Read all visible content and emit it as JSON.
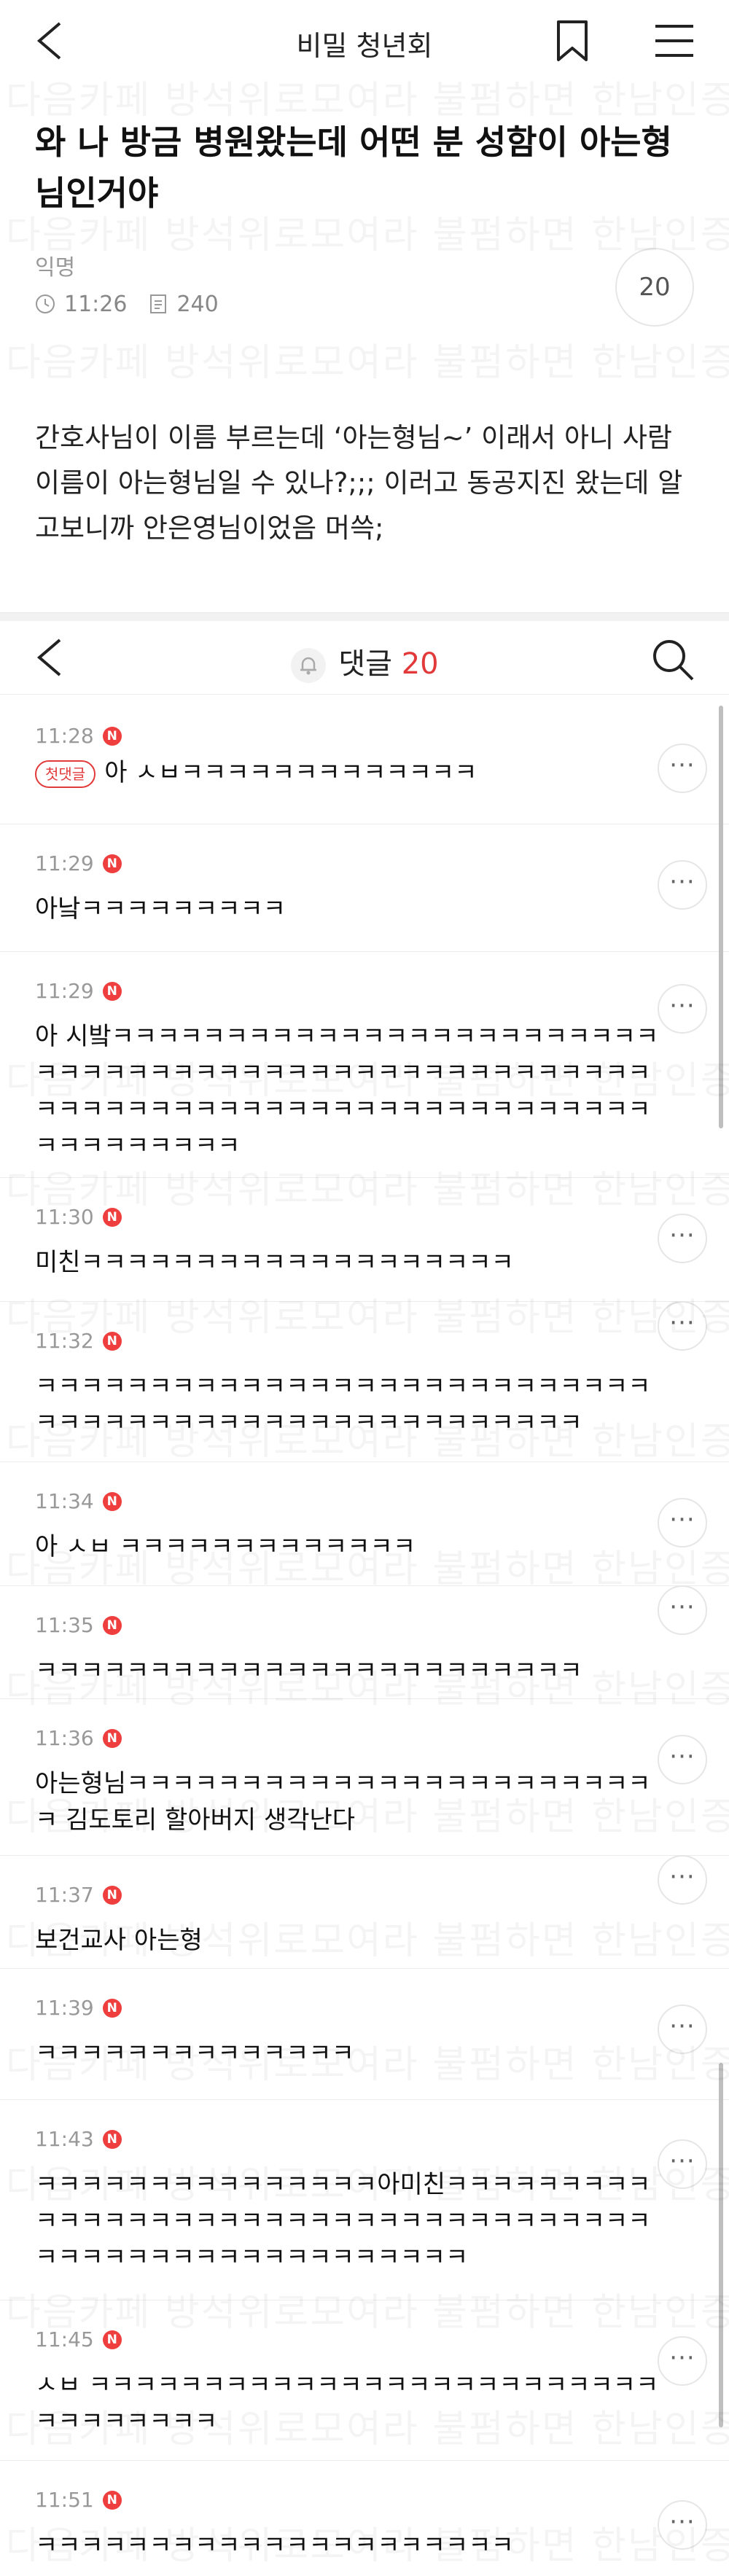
{
  "header": {
    "title": "비밀 청년회"
  },
  "post": {
    "title": "와 나 방금 병원왔는데 어떤 분 성함이 아는형님인거야",
    "author": "익명",
    "time": "11:26",
    "views": "240",
    "comment_count": "20",
    "body": "간호사님이 이름 부르는데 ‘아는형님~’ 이래서 아니 사람 이름이 아는형님일 수 있나?;;; 이러고 동공지진 왔는데 알고보니까 안은영님이었음 머쓱;"
  },
  "comments_header": {
    "label": "댓글",
    "count": "20"
  },
  "badge_letter": "N",
  "first_comment_badge": "첫댓글",
  "more_glyph": "···",
  "watermark": "다음카페 방석위로모여라 불펌하면 한남인증",
  "comments": [
    {
      "time": "11:28",
      "text": "아 ㅅㅂㅋㅋㅋㅋㅋㅋㅋㅋㅋㅋㅋㅋㅋ"
    },
    {
      "time": "11:29",
      "text": "아낰ㅋㅋㅋㅋㅋㅋㅋㅋㅋ"
    },
    {
      "time": "11:29",
      "text": "아 시밬ㅋㅋㅋㅋㅋㅋㅋㅋㅋㅋㅋㅋㅋㅋㅋㅋㅋㅋㅋㅋㅋㅋㅋㅋㅋㅋㅋㅋㅋㅋㅋㅋㅋㅋㅋㅋㅋㅋㅋㅋㅋㅋㅋㅋㅋㅋㅋㅋㅋㅋㅋㅋㅋㅋㅋㅋㅋㅋㅋㅋㅋㅋㅋㅋㅋㅋㅋㅋㅋㅋㅋㅋㅋㅋㅋㅋㅋㅋㅋㅋㅋㅋㅋㅋㅋㅋㅋ"
    },
    {
      "time": "11:30",
      "text": "미친ㅋㅋㅋㅋㅋㅋㅋㅋㅋㅋㅋㅋㅋㅋㅋㅋㅋㅋㅋ"
    },
    {
      "time": "11:32",
      "text": "ㅋㅋㅋㅋㅋㅋㅋㅋㅋㅋㅋㅋㅋㅋㅋㅋㅋㅋㅋㅋㅋㅋㅋㅋㅋㅋㅋㅋㅋㅋㅋㅋㅋㅋㅋㅋㅋㅋㅋㅋㅋㅋㅋㅋㅋㅋㅋㅋㅋㅋㅋ"
    },
    {
      "time": "11:34",
      "text": "아 ㅅㅂ ㅋㅋㅋㅋㅋㅋㅋㅋㅋㅋㅋㅋㅋ"
    },
    {
      "time": "11:35",
      "text": "ㅋㅋㅋㅋㅋㅋㅋㅋㅋㅋㅋㅋㅋㅋㅋㅋㅋㅋㅋㅋㅋㅋㅋㅋ"
    },
    {
      "time": "11:36",
      "text": "아는형님ㅋㅋㅋㅋㅋㅋㅋㅋㅋㅋㅋㅋㅋㅋㅋㅋㅋㅋㅋㅋㅋㅋㅋㅋ 김도토리 할아버지 생각난다"
    },
    {
      "time": "11:37",
      "text": "보건교사 아는형"
    },
    {
      "time": "11:39",
      "text": "ㅋㅋㅋㅋㅋㅋㅋㅋㅋㅋㅋㅋㅋㅋ"
    },
    {
      "time": "11:43",
      "text": "ㅋㅋㅋㅋㅋㅋㅋㅋㅋㅋㅋㅋㅋㅋㅋ아미친ㅋㅋㅋㅋㅋㅋㅋㅋㅋㅋㅋㅋㅋㅋㅋㅋㅋㅋㅋㅋㅋㅋㅋㅋㅋㅋㅋㅋㅋㅋㅋㅋㅋㅋㅋㅋㅋㅋㅋㅋㅋㅋㅋㅋㅋㅋㅋㅋㅋㅋㅋㅋㅋㅋㅋ"
    },
    {
      "time": "11:45",
      "text": "ㅅㅂ ㅋㅋㅋㅋㅋㅋㅋㅋㅋㅋㅋㅋㅋㅋㅋㅋㅋㅋㅋㅋㅋㅋㅋㅋㅋㅋㅋㅋㅋㅋㅋㅋㅋ"
    },
    {
      "time": "11:51",
      "text": "ㅋㅋㅋㅋㅋㅋㅋㅋㅋㅋㅋㅋㅋㅋㅋㅋㅋㅋㅋㅋㅋ"
    }
  ]
}
